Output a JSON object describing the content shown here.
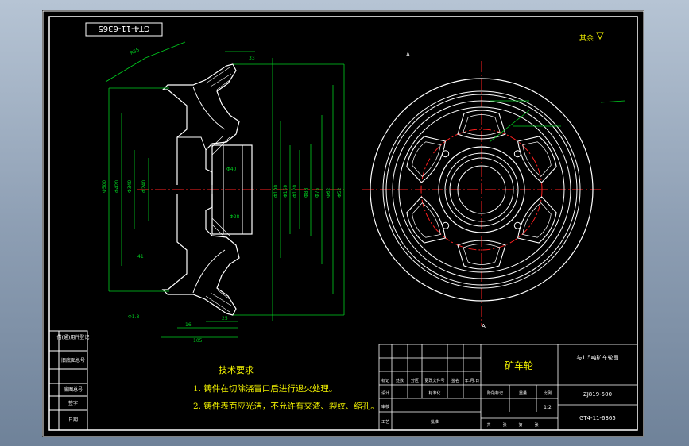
{
  "title_block": {
    "product_name": "矿车轮",
    "drawing_title": "与1.5吨矿车轮图",
    "code_upper": "ZJ819-500",
    "drawing_number": "GT4-11-6365",
    "scale": "1:2",
    "rev_headers": [
      "标记",
      "处数",
      "分区",
      "更改文件号",
      "签名",
      "年.月.日"
    ],
    "signature_rows": [
      "设计",
      "审核",
      "工艺"
    ],
    "signature_misc": [
      "标准化",
      "批准"
    ],
    "stage_labels": [
      "阶段标记",
      "重量",
      "比例"
    ],
    "sheet_labels": [
      "共",
      "张",
      "第",
      "张"
    ]
  },
  "left_strip": {
    "labels": [
      "借(通)用件登记",
      "旧底图总号",
      "底图总号",
      "签字",
      "日期"
    ]
  },
  "stamp_top": "GT4-11-6365",
  "roughness_note": "其余",
  "tech_requirements": {
    "title": "技术要求",
    "items": [
      "1. 铸件在切除浇冒口后进行退火处理。",
      "2. 铸件表面应光洁，不允许有夹渣、裂纹、缩孔。"
    ]
  },
  "section_labels": {
    "cut_a_left": "A",
    "cut_a_right": "A",
    "r_label": "R55",
    "dims": [
      "Φ500",
      "Φ420",
      "Φ340",
      "Φ240",
      "Φ190",
      "Φ160",
      "Φ120",
      "Φ88",
      "Φ75",
      "Φ62",
      "Φ52",
      "Φ40",
      "Φ28",
      "105",
      "16",
      "25",
      "33",
      "41",
      "Φ1.8"
    ]
  },
  "colors": {
    "drawing": "#ffffff",
    "dimension": "#00d020",
    "center": "#ff2020",
    "text": "#f0f0f0",
    "cn_text": "#f0f000"
  }
}
